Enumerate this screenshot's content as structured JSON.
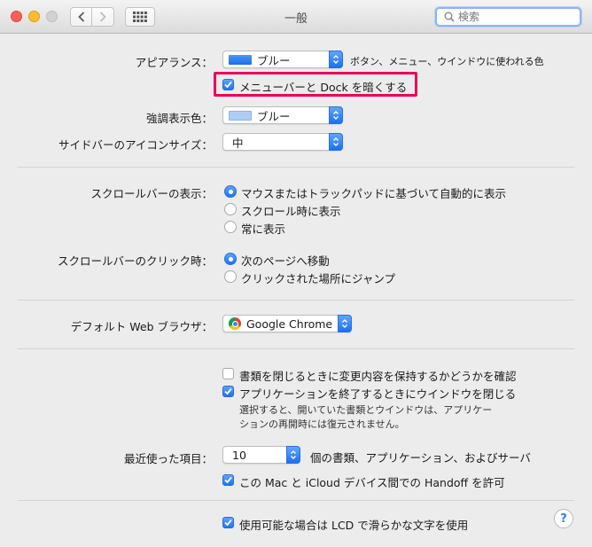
{
  "window": {
    "title": "一般"
  },
  "search": {
    "placeholder": "検索"
  },
  "appearance": {
    "label": "アピアランス：",
    "value": "ブルー",
    "swatch_color": "#2b7af0",
    "note": "ボタン、メニュー、ウインドウに使われる色",
    "dark_menu_label": "メニューバーと Dock を暗くする",
    "dark_menu_checked": true
  },
  "highlight": {
    "label": "強調表示色：",
    "value": "ブルー",
    "swatch_color": "#aecdf5"
  },
  "sidebar_icon": {
    "label": "サイドバーのアイコンサイズ：",
    "value": "中"
  },
  "scrollbar_show": {
    "label": "スクロールバーの表示：",
    "options": [
      "マウスまたはトラックパッドに基づいて自動的に表示",
      "スクロール時に表示",
      "常に表示"
    ],
    "selected": 0
  },
  "scrollbar_click": {
    "label": "スクロールバーのクリック時：",
    "options": [
      "次のページへ移動",
      "クリックされた場所にジャンプ"
    ],
    "selected": 0
  },
  "browser": {
    "label": "デフォルト Web ブラウザ：",
    "value": "Google Chrome"
  },
  "documents": {
    "ask_keep_changes": "書類を閉じるときに変更内容を保持するかどうかを確認",
    "ask_keep_changes_checked": false,
    "close_windows": "アプリケーションを終了するときにウインドウを閉じる",
    "close_windows_checked": true,
    "close_windows_note": "選択すると、開いていた書類とウインドウは、アプリケーションの再開時には復元されません。"
  },
  "recent": {
    "label": "最近使った項目：",
    "value": "10",
    "suffix": "個の書類、アプリケーション、およびサーバ"
  },
  "handoff": {
    "label": "この Mac と iCloud デバイス間での Handoff を許可",
    "checked": true
  },
  "lcd": {
    "label": "使用可能な場合は LCD で滑らかな文字を使用",
    "checked": true
  },
  "help": {
    "label": "?"
  }
}
